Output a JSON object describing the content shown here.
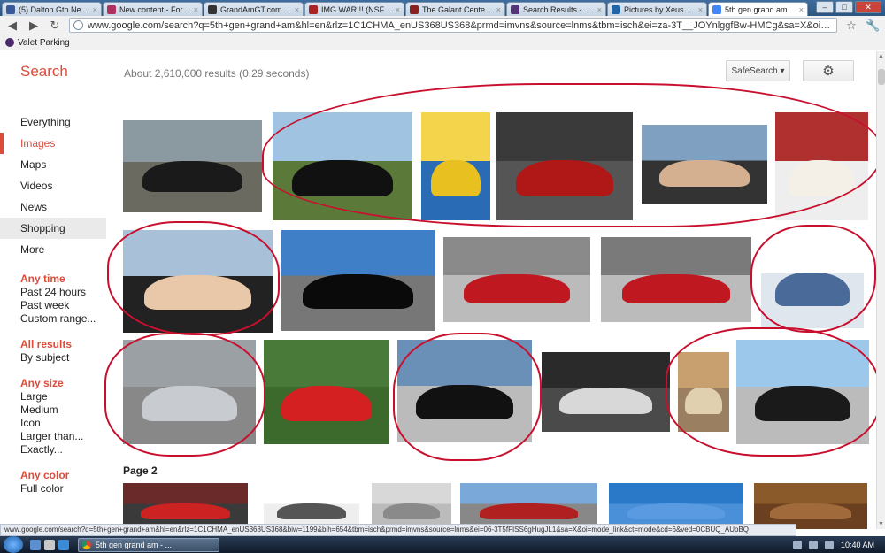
{
  "browser": {
    "tabs": [
      {
        "label": "(5) Dalton Gtp Neamt...",
        "favicon": "facebook-icon",
        "color": "#3b5998"
      },
      {
        "label": "New content - Forev...",
        "favicon": "forum-icon",
        "color": "#b03060"
      },
      {
        "label": "GrandAmGT.com Fo...",
        "favicon": "site-icon",
        "color": "#333333"
      },
      {
        "label": "IMG WAR!!! (NSFW)",
        "favicon": "site-icon",
        "color": "#aa2222"
      },
      {
        "label": "The Galant Center - G",
        "favicon": "site-icon",
        "color": "#882222"
      },
      {
        "label": "Search Results - Full...",
        "favicon": "site-icon",
        "color": "#553377"
      },
      {
        "label": "Pictures by Xeus59 -",
        "favicon": "photobucket-icon",
        "color": "#2266aa"
      },
      {
        "label": "5th gen grand am - G",
        "favicon": "google-icon",
        "color": "#4285f4"
      }
    ],
    "url": "www.google.com/search?q=5th+gen+grand+am&hl=en&rlz=1C1CHMA_enUS368US368&prmd=imvns&source=lnms&tbm=isch&ei=za-3T__JOYnlggfBw-HMCg&sa=X&oi=mode_link&ct=mo",
    "bookmark": "Valet Parking"
  },
  "search": {
    "brand": "Search",
    "stats": "About 2,610,000 results (0.29 seconds)",
    "safesearch": "SafeSearch ▾",
    "settings_icon": "gear-icon",
    "accent": "#dd4b39"
  },
  "nav": [
    {
      "label": "Everything"
    },
    {
      "label": "Images",
      "active": true
    },
    {
      "label": "Maps"
    },
    {
      "label": "Videos"
    },
    {
      "label": "News"
    },
    {
      "label": "Shopping"
    },
    {
      "label": "More"
    }
  ],
  "filters": [
    {
      "heading": "Any time",
      "items": [
        "Past 24 hours",
        "Past week",
        "Custom range..."
      ]
    },
    {
      "heading": "All results",
      "items": [
        "By subject"
      ]
    },
    {
      "heading": "Any size",
      "items": [
        "Large",
        "Medium",
        "Icon",
        "Larger than...",
        "Exactly..."
      ]
    },
    {
      "heading": "Any color",
      "items": [
        "Full color"
      ]
    }
  ],
  "page2_label": "Page 2",
  "images": [
    {
      "alt": "black grand am parked",
      "sky": "#8a9aa0",
      "ground": "#6a6a60",
      "car": "#1a1a1a"
    },
    {
      "alt": "black grand am on grass",
      "sky": "#9fc3e0",
      "ground": "#5b7a3a",
      "car": "#111111"
    },
    {
      "alt": "Jesus on grand am poster",
      "sky": "#f4d44a",
      "ground": "#2a6bb5",
      "car": "#e8c020"
    },
    {
      "alt": "red hot rod coupe",
      "sky": "#3a3a3a",
      "ground": "#555555",
      "car": "#b01818"
    },
    {
      "alt": "two women in a car",
      "sky": "#7fa0c0",
      "ground": "#333333",
      "car": "#d4b090"
    },
    {
      "alt": "white cat meme face",
      "sky": "#b03030",
      "ground": "#eeeeee",
      "car": "#f4f0e8"
    },
    {
      "alt": "woman driving car interior",
      "sky": "#a8c0d8",
      "ground": "#222222",
      "car": "#e8c8a8"
    },
    {
      "alt": "black grand am at court",
      "sky": "#3f7fc8",
      "ground": "#777777",
      "car": "#0a0a0a"
    },
    {
      "alt": "red viper front",
      "sky": "#8a8a8a",
      "ground": "#bbbbbb",
      "car": "#c01820"
    },
    {
      "alt": "red viper side",
      "sky": "#7a7a7a",
      "ground": "#bbbbbb",
      "car": "#c01820"
    },
    {
      "alt": "forum webpage screenshot",
      "sky": "#ffffff",
      "ground": "#e0e6ee",
      "car": "#4a6a9a"
    },
    {
      "alt": "silver ford focus",
      "sky": "#9aa0a4",
      "ground": "#888888",
      "car": "#c8ccd0"
    },
    {
      "alt": "red camaro",
      "sky": "#4a7a3a",
      "ground": "#3c6a2c",
      "car": "#d42020"
    },
    {
      "alt": "black cadillac cts city",
      "sky": "#6a90b8",
      "ground": "#bbbbbb",
      "car": "#111111"
    },
    {
      "alt": "race car motorsport",
      "sky": "#2a2a2a",
      "ground": "#4a4a4a",
      "car": "#d8d8d8"
    },
    {
      "alt": "couple photos collage",
      "sky": "#c8a070",
      "ground": "#9a8060",
      "car": "#e0d0b0"
    },
    {
      "alt": "black chrysler 300 palms",
      "sky": "#9cc8ec",
      "ground": "#bbbbbb",
      "car": "#1a1a1a"
    },
    {
      "alt": "red car garage",
      "sky": "#6a2a2a",
      "ground": "#3a3a3a",
      "car": "#cc2222"
    },
    {
      "alt": "car wheel rim",
      "sky": "#ffffff",
      "ground": "#eeeeee",
      "car": "#555555"
    },
    {
      "alt": "car side mirror",
      "sky": "#d8d8d8",
      "ground": "#bbbbbb",
      "car": "#8a8a8a"
    },
    {
      "alt": "red car street",
      "sky": "#7aa8d8",
      "ground": "#888888",
      "car": "#b02020"
    },
    {
      "alt": "blue sky parking",
      "sky": "#2a78c8",
      "ground": "#4a90d8",
      "car": "#5a9ae0"
    },
    {
      "alt": "wood interior trim",
      "sky": "#8a5a2a",
      "ground": "#6a4020",
      "car": "#a06a3a"
    }
  ],
  "status": "www.google.com/search?q=5th+gen+grand+am&hl=en&rlz=1C1CHMA_enUS368US368&biw=1199&bih=654&tbm=isch&prmd=imvns&source=lnms&ei=06-3T5fFISS6gHugJL1&sa=X&oi=mode_link&ct=mode&cd=6&ved=0CBUQ_AUoBQ",
  "taskbar": {
    "task_label": "5th gen grand am - ...",
    "clock": "10:40 AM"
  }
}
